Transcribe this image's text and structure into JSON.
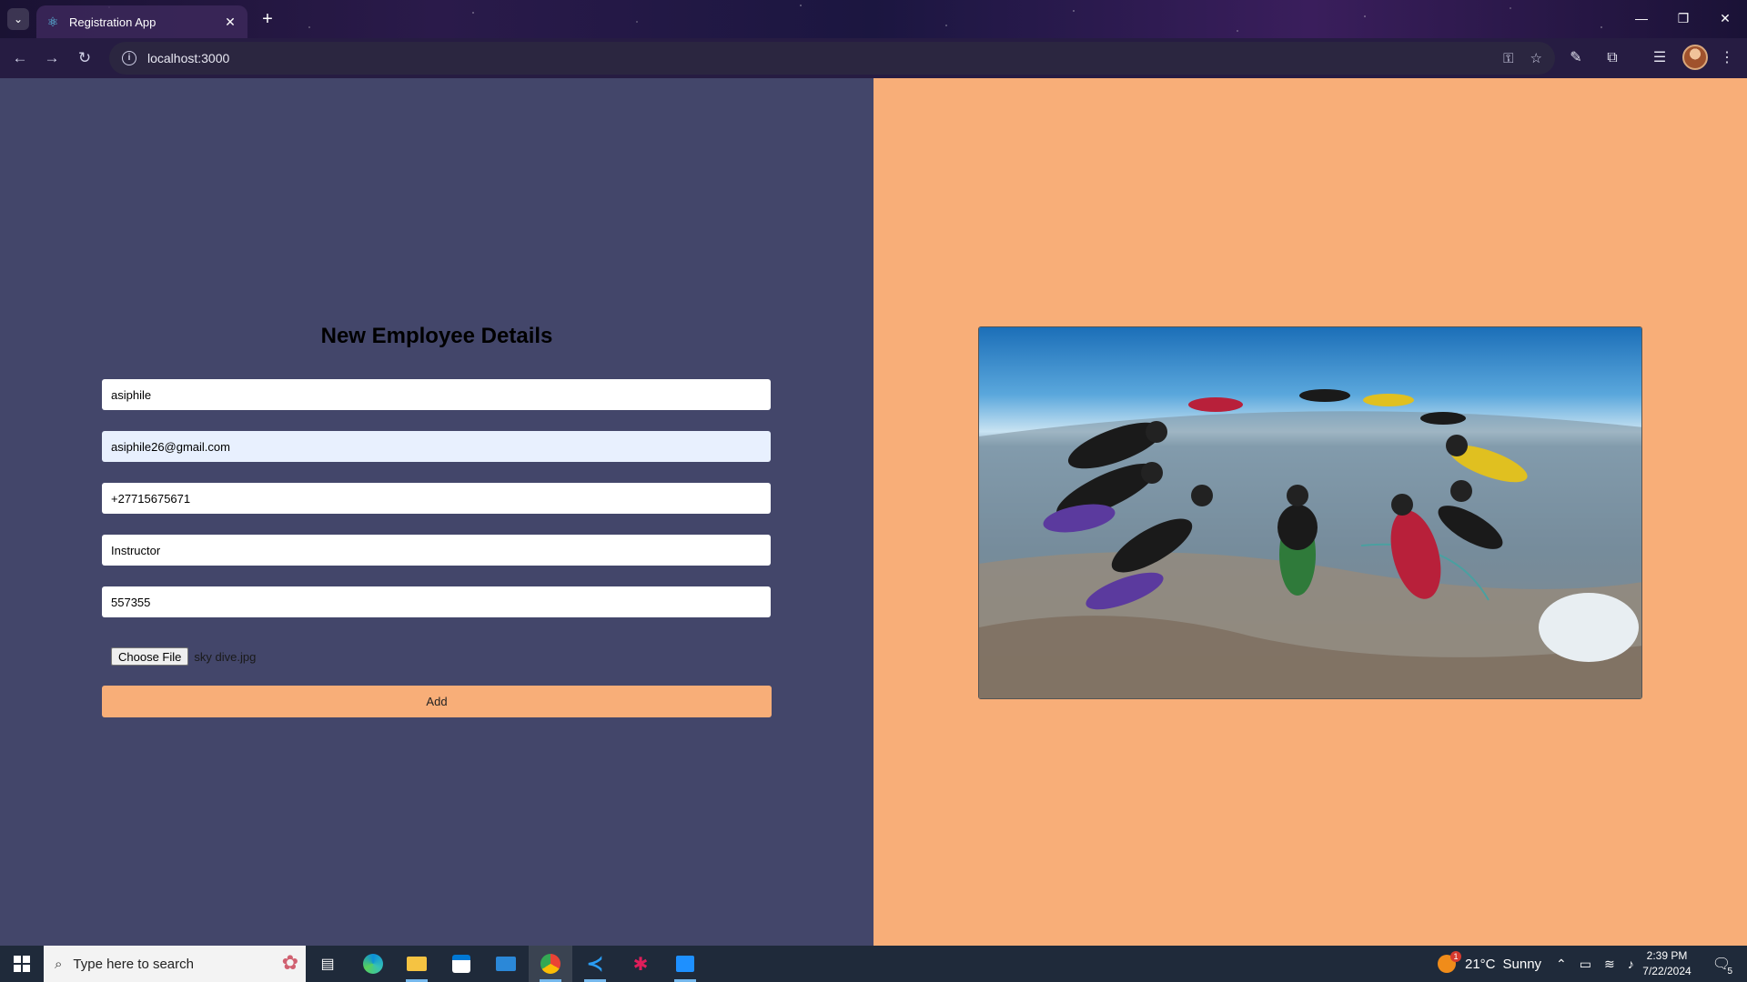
{
  "browser": {
    "tab_title": "Registration App",
    "url": "localhost:3000"
  },
  "form": {
    "title": "New Employee Details",
    "fields": [
      {
        "value": "asiphile"
      },
      {
        "value": "asiphile26@gmail.com"
      },
      {
        "value": "+27715675671"
      },
      {
        "value": "Instructor"
      },
      {
        "value": "557355"
      }
    ],
    "choose_file_label": "Choose File",
    "file_name": "sky dive.jpg",
    "add_label": "Add"
  },
  "colors": {
    "left_bg": "#43466a",
    "accent": "#f8ae78"
  },
  "taskbar": {
    "search_placeholder": "Type here to search",
    "weather_temp": "21°C",
    "weather_desc": "Sunny",
    "time": "2:39 PM",
    "date": "7/22/2024",
    "notification_count": "5",
    "weather_badge": "1"
  }
}
